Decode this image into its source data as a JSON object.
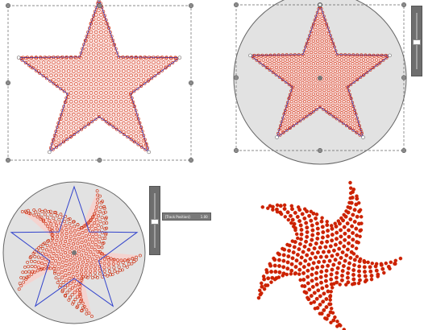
{
  "tooltip": {
    "label": "[Track Position]:",
    "value": "1.00"
  },
  "sliders": {
    "top_right_level": 0.5,
    "bottom_left_level": 0.5
  },
  "colors": {
    "stone": "#cc2200",
    "outline": "#3344cc",
    "disc_fill": "#e2e2e2",
    "selection": "#666666",
    "handle": "#8a8a8a",
    "slider": "#6e6e6e"
  }
}
